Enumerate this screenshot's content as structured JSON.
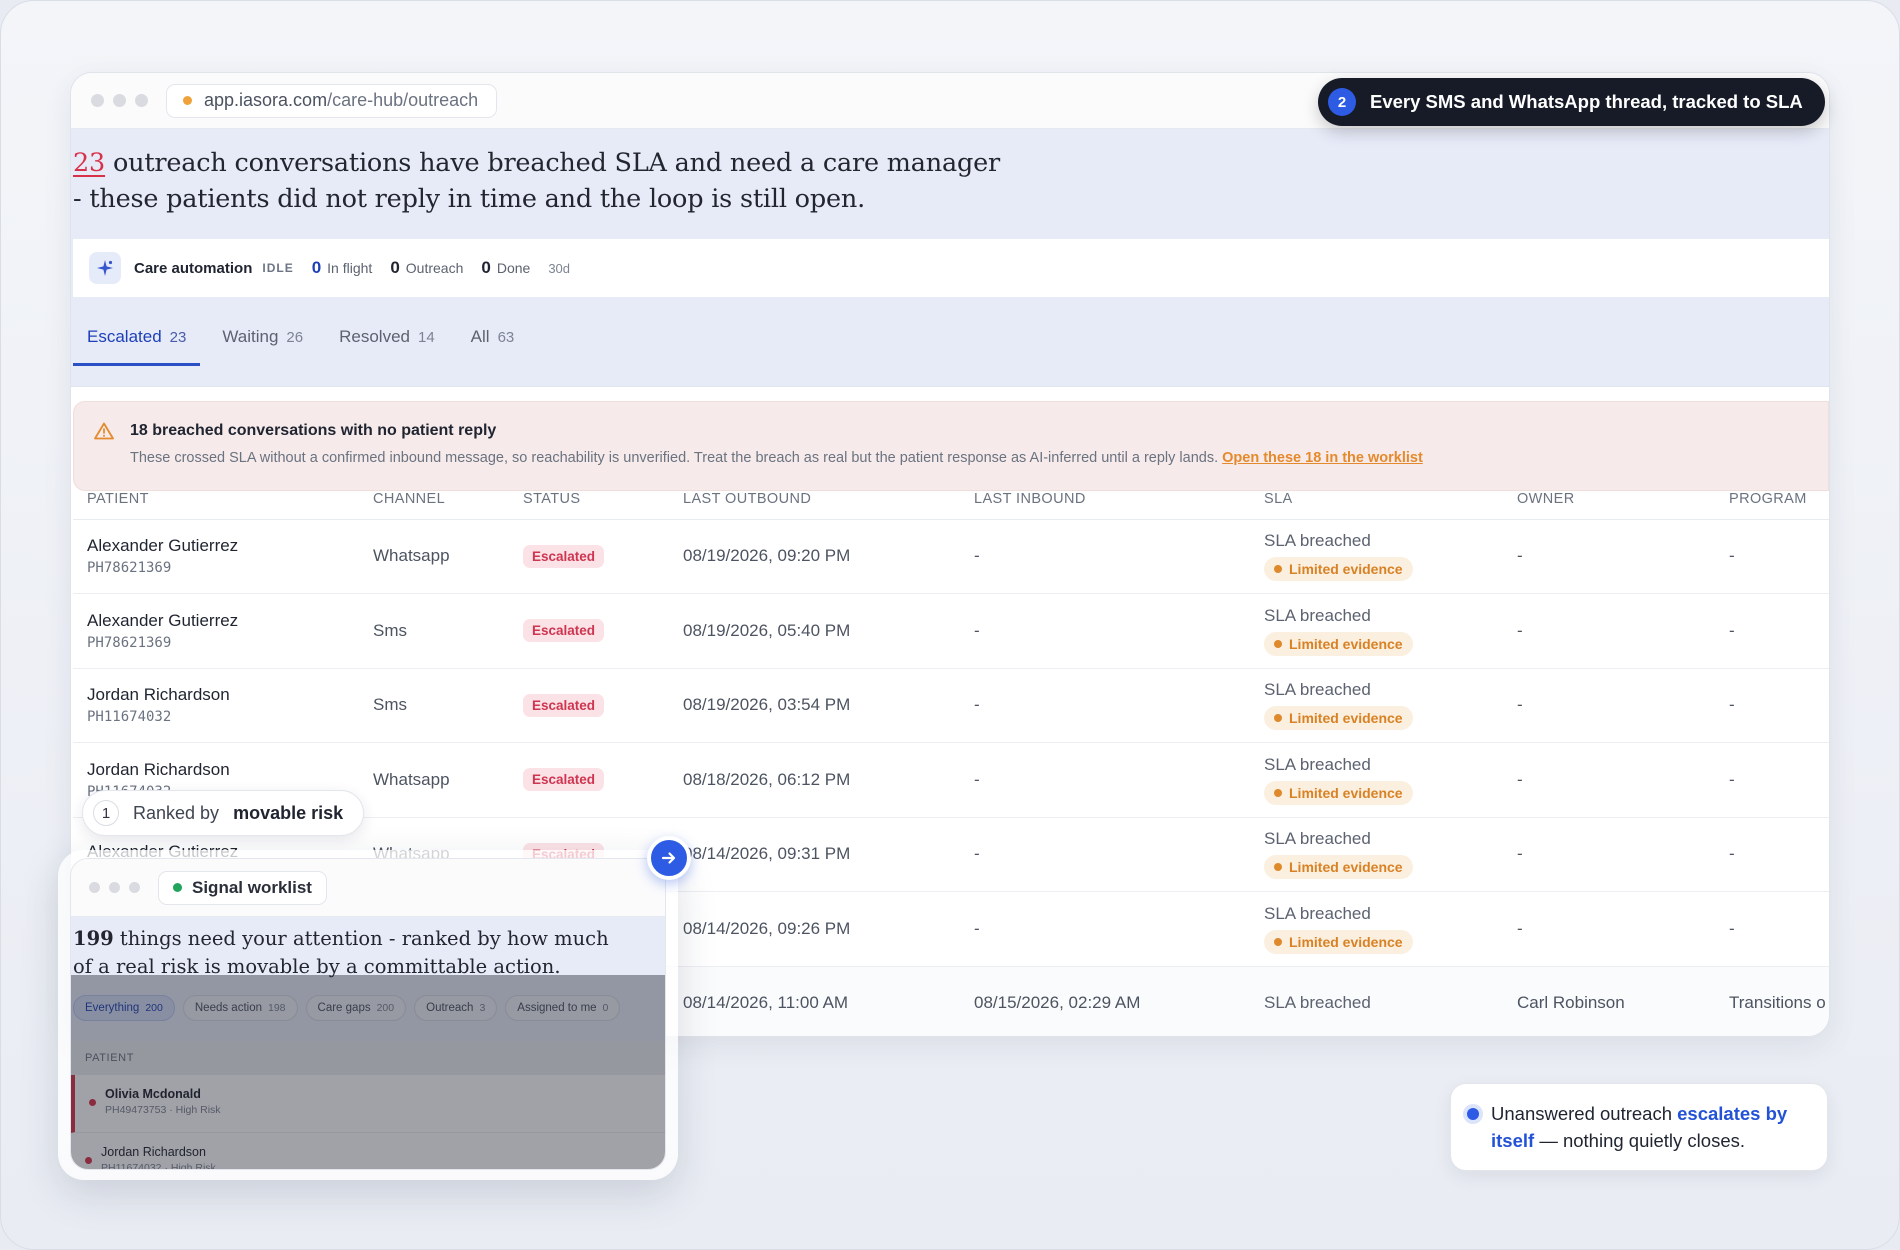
{
  "browser": {
    "url_host": "app.iasora.com",
    "url_path": "/care-hub/outreach"
  },
  "callout_top": {
    "number": "2",
    "text": "Every SMS and WhatsApp thread, tracked to SLA"
  },
  "hero": {
    "count": "23",
    "line1_rest": " outreach conversations have breached SLA and need a care manager",
    "line2": "- these patients did not reply in time and the loop is still open."
  },
  "automation": {
    "title": "Care automation",
    "state": "IDLE",
    "in_flight_value": "0",
    "in_flight_label": "In flight",
    "outreach_value": "0",
    "outreach_label": "Outreach",
    "done_value": "0",
    "done_label": "Done",
    "range": "30d"
  },
  "tabs": [
    {
      "label": "Escalated",
      "count": "23",
      "active": true
    },
    {
      "label": "Waiting",
      "count": "26"
    },
    {
      "label": "Resolved",
      "count": "14"
    },
    {
      "label": "All",
      "count": "63"
    }
  ],
  "alert": {
    "title": "18 breached conversations with no patient reply",
    "body": "These crossed SLA without a confirmed inbound message, so reachability is unverified. Treat the breach as real but the patient response as AI-inferred until a reply lands. ",
    "link": "Open these 18 in the worklist"
  },
  "table": {
    "headers": [
      "PATIENT",
      "CHANNEL",
      "STATUS",
      "LAST OUTBOUND",
      "LAST INBOUND",
      "SLA",
      "OWNER",
      "PROGRAM"
    ],
    "rows": [
      {
        "name": "Alexander Gutierrez",
        "id": "PH78621369",
        "channel": "Whatsapp",
        "status": "Escalated",
        "last_outbound": "08/19/2026, 09:20 PM",
        "last_inbound": "-",
        "sla": "SLA breached",
        "evidence": "Limited evidence",
        "owner": "-",
        "program": "-"
      },
      {
        "name": "Alexander Gutierrez",
        "id": "PH78621369",
        "channel": "Sms",
        "status": "Escalated",
        "last_outbound": "08/19/2026, 05:40 PM",
        "last_inbound": "-",
        "sla": "SLA breached",
        "evidence": "Limited evidence",
        "owner": "-",
        "program": "-"
      },
      {
        "name": "Jordan Richardson",
        "id": "PH11674032",
        "channel": "Sms",
        "status": "Escalated",
        "last_outbound": "08/19/2026, 03:54 PM",
        "last_inbound": "-",
        "sla": "SLA breached",
        "evidence": "Limited evidence",
        "owner": "-",
        "program": "-"
      },
      {
        "name": "Jordan Richardson",
        "id": "PH11674032",
        "channel": "Whatsapp",
        "status": "Escalated",
        "last_outbound": "08/18/2026, 06:12 PM",
        "last_inbound": "-",
        "sla": "SLA breached",
        "evidence": "Limited evidence",
        "owner": "-",
        "program": "-"
      },
      {
        "name": "Alexander Gutierrez",
        "id": "",
        "channel": "Whatsapp",
        "status": "Escalated",
        "last_outbound": "08/14/2026, 09:31 PM",
        "last_inbound": "-",
        "sla": "SLA breached",
        "evidence": "Limited evidence",
        "owner": "-",
        "program": "-"
      },
      {
        "name": "",
        "id": "",
        "channel": "",
        "status": "",
        "last_outbound": "08/14/2026, 09:26 PM",
        "last_inbound": "-",
        "sla": "SLA breached",
        "evidence": "Limited evidence",
        "owner": "-",
        "program": "-"
      },
      {
        "name": "",
        "id": "",
        "channel": "",
        "status": "",
        "last_outbound": "08/14/2026, 11:00 AM",
        "last_inbound": "08/15/2026, 02:29 AM",
        "sla": "SLA breached",
        "evidence": "",
        "owner": "Carl Robinson",
        "program": "Transitions o"
      }
    ]
  },
  "ranked": {
    "number": "1",
    "prefix": "Ranked by",
    "emphasis": "movable risk"
  },
  "worklist": {
    "tab_label": "Signal worklist",
    "count": "199",
    "line1_rest": " things need your attention - ranked by how much",
    "line2": "of a real risk is movable by a committable action.",
    "chips": [
      {
        "label": "Everything",
        "count": "200",
        "active": true
      },
      {
        "label": "Needs action",
        "count": "198"
      },
      {
        "label": "Care gaps",
        "count": "200"
      },
      {
        "label": "Outreach",
        "count": "3"
      },
      {
        "label": "Assigned to me",
        "count": "0"
      }
    ],
    "header": "PATIENT",
    "rows": [
      {
        "name": "Olivia Mcdonald",
        "sub": "PH49473753 · High Risk"
      },
      {
        "name": "Jordan Richardson",
        "sub": "PH11674032 · High Risk"
      }
    ]
  },
  "note": {
    "before": "Unanswered outreach ",
    "highlight": "escalates by itself",
    "after": " — nothing quietly closes."
  },
  "colors": {
    "accent": "#2d5be3",
    "danger": "#d8324b",
    "warning": "#df8a2a",
    "dark": "#161b27"
  }
}
